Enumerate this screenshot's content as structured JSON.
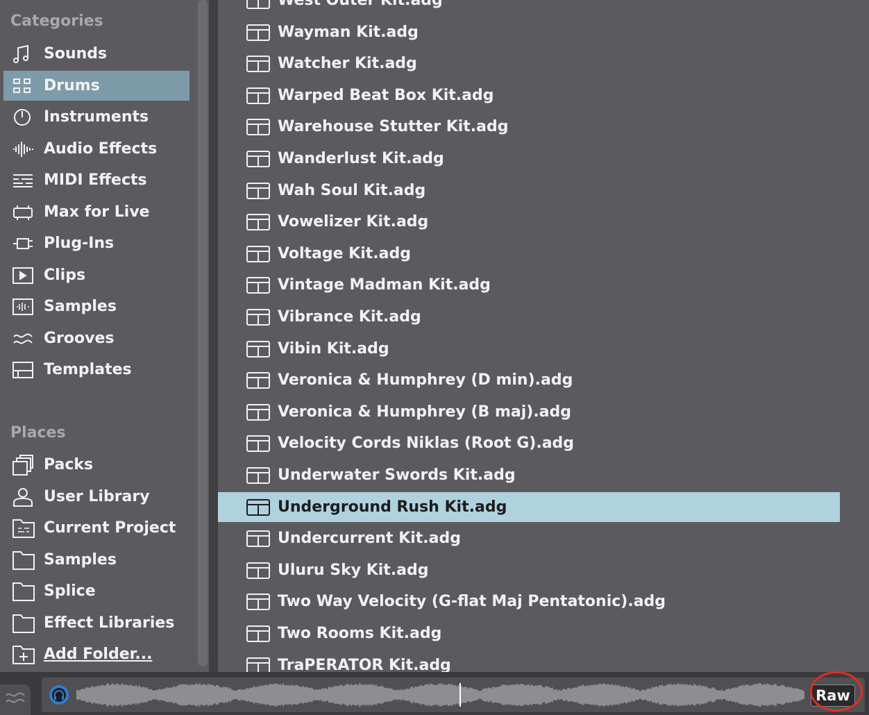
{
  "sidebar": {
    "categories_title": "Categories",
    "categories": [
      {
        "label": "Sounds",
        "icon": "note-icon"
      },
      {
        "label": "Drums",
        "icon": "grid-icon",
        "selected": true
      },
      {
        "label": "Instruments",
        "icon": "power-icon"
      },
      {
        "label": "Audio Effects",
        "icon": "waveform-icon"
      },
      {
        "label": "MIDI Effects",
        "icon": "midi-lines-icon"
      },
      {
        "label": "Max for Live",
        "icon": "max-device-icon"
      },
      {
        "label": "Plug-Ins",
        "icon": "plug-icon"
      },
      {
        "label": "Clips",
        "icon": "play-box-icon"
      },
      {
        "label": "Samples",
        "icon": "sample-box-icon"
      },
      {
        "label": "Grooves",
        "icon": "grooves-icon"
      },
      {
        "label": "Templates",
        "icon": "template-icon"
      }
    ],
    "places_title": "Places",
    "places": [
      {
        "label": "Packs",
        "icon": "packs-icon"
      },
      {
        "label": "User Library",
        "icon": "user-icon"
      },
      {
        "label": "Current Project",
        "icon": "project-folder-icon"
      },
      {
        "label": "Samples",
        "icon": "folder-icon"
      },
      {
        "label": "Splice",
        "icon": "folder-icon"
      },
      {
        "label": "Effect Libraries",
        "icon": "folder-icon"
      },
      {
        "label": "Add Folder...",
        "icon": "add-folder-icon"
      }
    ]
  },
  "files": [
    "West Outer Kit.adg",
    "Wayman Kit.adg",
    "Watcher Kit.adg",
    "Warped Beat Box Kit.adg",
    "Warehouse Stutter Kit.adg",
    "Wanderlust Kit.adg",
    "Wah Soul Kit.adg",
    "Vowelizer Kit.adg",
    "Voltage Kit.adg",
    "Vintage Madman Kit.adg",
    "Vibrance Kit.adg",
    "Vibin Kit.adg",
    "Veronica & Humphrey (D min).adg",
    "Veronica & Humphrey (B maj).adg",
    "Velocity Cords Niklas (Root G).adg",
    "Underwater Swords Kit.adg",
    "Underground Rush Kit.adg",
    "Undercurrent Kit.adg",
    "Uluru Sky Kit.adg",
    "Two Way Velocity (G-flat Maj Pentatonic).adg",
    "Two Rooms Kit.adg",
    "TraPERATOR Kit.adg"
  ],
  "selected_file": "Underground Rush Kit.adg",
  "preview": {
    "raw_label": "Raw",
    "icons": {
      "toggle": "grooves-icon",
      "preview": "headphones-icon"
    }
  },
  "colors": {
    "panel": "#5b5b5f",
    "selected_category": "#7e9ba9",
    "selected_file": "#b0d2de",
    "highlight_circle": "#e02f20"
  }
}
